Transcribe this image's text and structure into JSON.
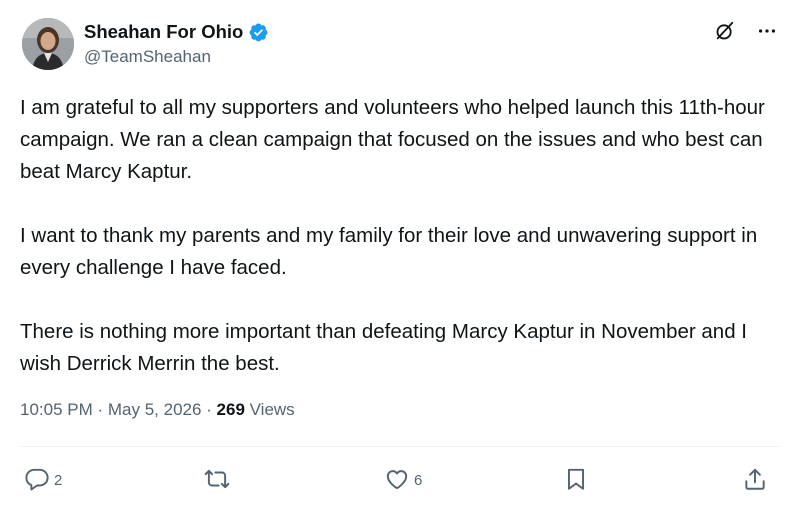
{
  "author": {
    "display_name": "Sheahan For Ohio",
    "handle": "@TeamSheahan",
    "verified_icon": "verified-badge-icon",
    "verified_color": "#1d9bf0"
  },
  "top_actions": {
    "grok_icon": "grok-icon",
    "more_icon": "more-options-icon"
  },
  "tweet": {
    "paragraphs": [
      "I am grateful to all my supporters and volunteers who helped launch this 11th-hour campaign. We ran a clean campaign that focused on the issues and who best can beat Marcy Kaptur.",
      "I want to thank my parents and my family for their love and unwavering support in every challenge I have faced.",
      "There is nothing more important than defeating Marcy Kaptur in November and I wish Derrick Merrin the best."
    ]
  },
  "meta": {
    "time": "10:05 PM",
    "separator": " · ",
    "date": "May 5, 2026",
    "views_count": "269",
    "views_label": " Views"
  },
  "actions": {
    "reply_count": "2",
    "retweet_count": "",
    "like_count": "6",
    "icons": [
      "reply-icon",
      "retweet-icon",
      "like-icon",
      "bookmark-icon",
      "share-icon"
    ]
  },
  "colors": {
    "text": "#0f1419",
    "secondary": "#536471",
    "accent": "#1d9bf0"
  }
}
